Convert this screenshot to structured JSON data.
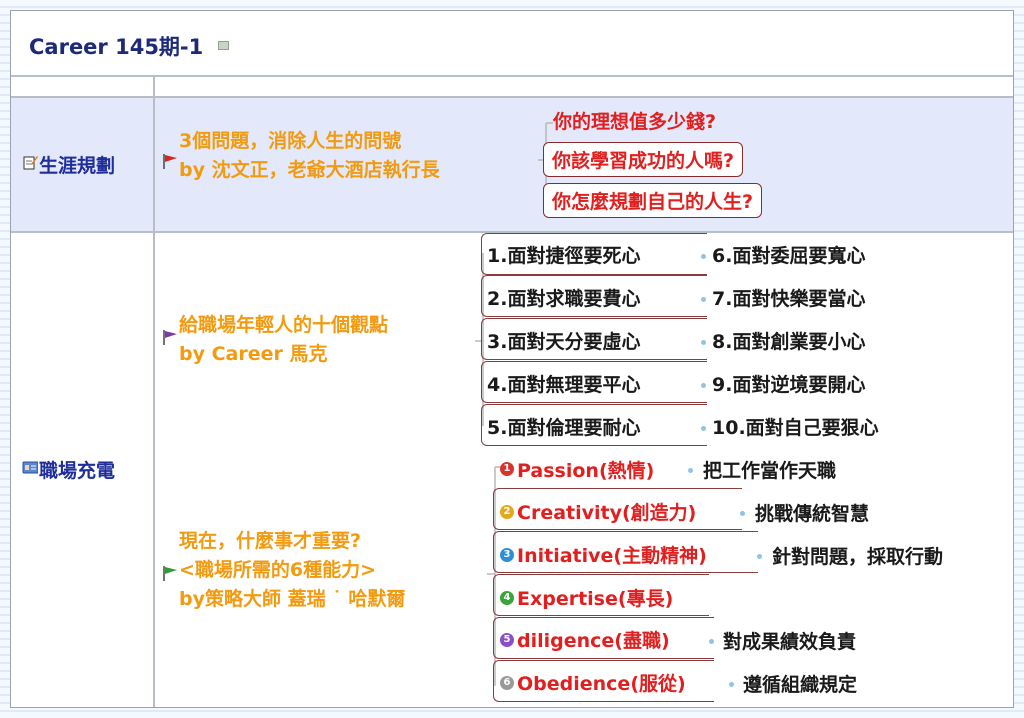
{
  "title": "Career 145期-1",
  "topics": [
    {
      "label": "生涯規劃",
      "icon": "notepad-edit-icon"
    },
    {
      "label": "職場充電",
      "icon": "id-card-icon"
    }
  ],
  "branch1": {
    "lines": [
      "3個問題，消除人生的問號",
      "by 沈文正，老爺大酒店執行長"
    ],
    "flag": "red-flag-icon",
    "items": [
      "你的理想值多少錢?",
      "你該學習成功的人嗎?",
      "你怎麼規劃自己的人生?"
    ]
  },
  "branch2": {
    "lines": [
      "給職場年輕人的十個觀點",
      "by Career 馬克"
    ],
    "flag": "purple-flag-icon",
    "left": [
      "1.面對捷徑要死心",
      "2.面對求職要費心",
      "3.面對天分要虛心",
      "4.面對無理要平心",
      "5.面對倫理要耐心"
    ],
    "right": [
      "6.面對委屈要寬心",
      "7.面對快樂要當心",
      "8.面對創業要小心",
      "9.面對逆境要開心",
      "10.面對自己要狠心"
    ]
  },
  "branch3": {
    "lines": [
      "現在，什麼事才重要?",
      "<職場所需的6種能力>",
      "by策略大師 蓋瑞 ˙ 哈默爾"
    ],
    "flag": "green-flag-icon",
    "abilities": [
      {
        "name": "Passion(熱情)",
        "desc": "把工作當作天職",
        "icon_color": "#d9342b"
      },
      {
        "name": "Creativity(創造力)",
        "desc": "挑戰傳統智慧",
        "icon_color": "#e5a81c"
      },
      {
        "name": "Initiative(主動精神)",
        "desc": "針對問題，採取行動",
        "icon_color": "#2c8fd6"
      },
      {
        "name": "Expertise(專長)",
        "desc": "",
        "icon_color": "#3aa53a"
      },
      {
        "name": "diligence(盡職)",
        "desc": "對成果績效負責",
        "icon_color": "#8a4fc4"
      },
      {
        "name": "Obedience(服從)",
        "desc": "遵循組織規定",
        "icon_color": "#9a9a9a"
      }
    ]
  },
  "colors": {
    "accent_blue": "#1f2e9a",
    "orange": "#f29b10",
    "red": "#e21f1f",
    "row_bg": "#e3e9fb"
  }
}
